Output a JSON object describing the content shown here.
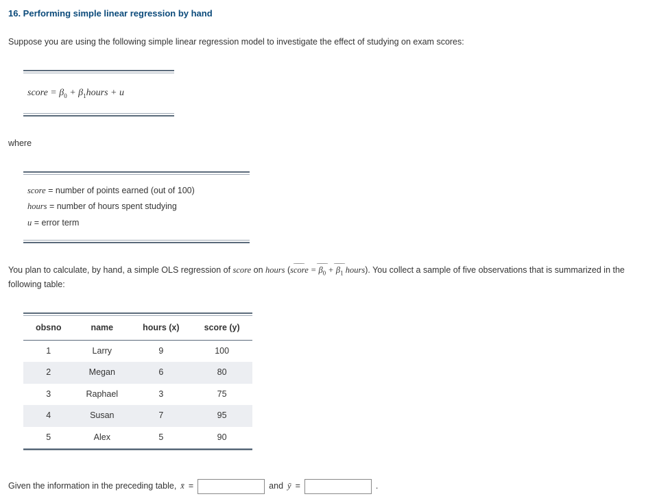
{
  "title": "16. Performing simple linear regression by hand",
  "intro": "Suppose you are using the following simple linear regression model to investigate the effect of studying on exam scores:",
  "equation": "score = β₀ + β₁hours + u",
  "where": "where",
  "defs": {
    "score_var": "score",
    "score_txt": " = number of points earned (out of 100)",
    "hours_var": "hours",
    "hours_txt": " = number of hours spent studying",
    "u_var": "u",
    "u_txt": " = error term"
  },
  "plan_a": "You plan to calculate, by hand, a simple OLS regression of ",
  "plan_score": "score",
  "plan_on": " on ",
  "plan_hours": "hours",
  "plan_paren_open": " (",
  "plan_hat_score": "score",
  "plan_eq": " = ",
  "plan_b0": "β",
  "plan_b0_sub": "0",
  "plan_plus": " + ",
  "plan_b1": "β",
  "plan_b1_sub": "1",
  "plan_hours2": " hours",
  "plan_paren_close": "). You collect a sample of five observations that is summarized in the following table:",
  "headers": {
    "obsno": "obsno",
    "name": "name",
    "hours": "hours (x)",
    "score": "score (y)"
  },
  "rows": [
    {
      "obsno": "1",
      "name": "Larry",
      "hours": "9",
      "score": "100"
    },
    {
      "obsno": "2",
      "name": "Megan",
      "hours": "6",
      "score": "80"
    },
    {
      "obsno": "3",
      "name": "Raphael",
      "hours": "3",
      "score": "75"
    },
    {
      "obsno": "4",
      "name": "Susan",
      "hours": "7",
      "score": "95"
    },
    {
      "obsno": "5",
      "name": "Alex",
      "hours": "5",
      "score": "90"
    }
  ],
  "final_a": "Given the information in the preceding table, ",
  "final_xbar": "x̄",
  "final_eq": " = ",
  "final_and": " and ",
  "final_ybar": "ȳ",
  "final_eq2": " = ",
  "final_period": " ."
}
